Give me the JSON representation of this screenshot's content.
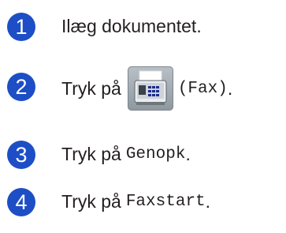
{
  "steps": [
    {
      "number": "1",
      "text": "Ilæg dokumentet."
    },
    {
      "number": "2",
      "prefix": "Tryk på",
      "icon": "fax-machine-icon",
      "code": "(Fax)",
      "suffix": "."
    },
    {
      "number": "3",
      "prefix": "Tryk på",
      "code": "Genopk",
      "suffix": "."
    },
    {
      "number": "4",
      "prefix": "Tryk på",
      "code": "Faxstart",
      "suffix": "."
    }
  ],
  "colors": {
    "step_badge": "#1d4ec6",
    "text": "#231f20"
  }
}
